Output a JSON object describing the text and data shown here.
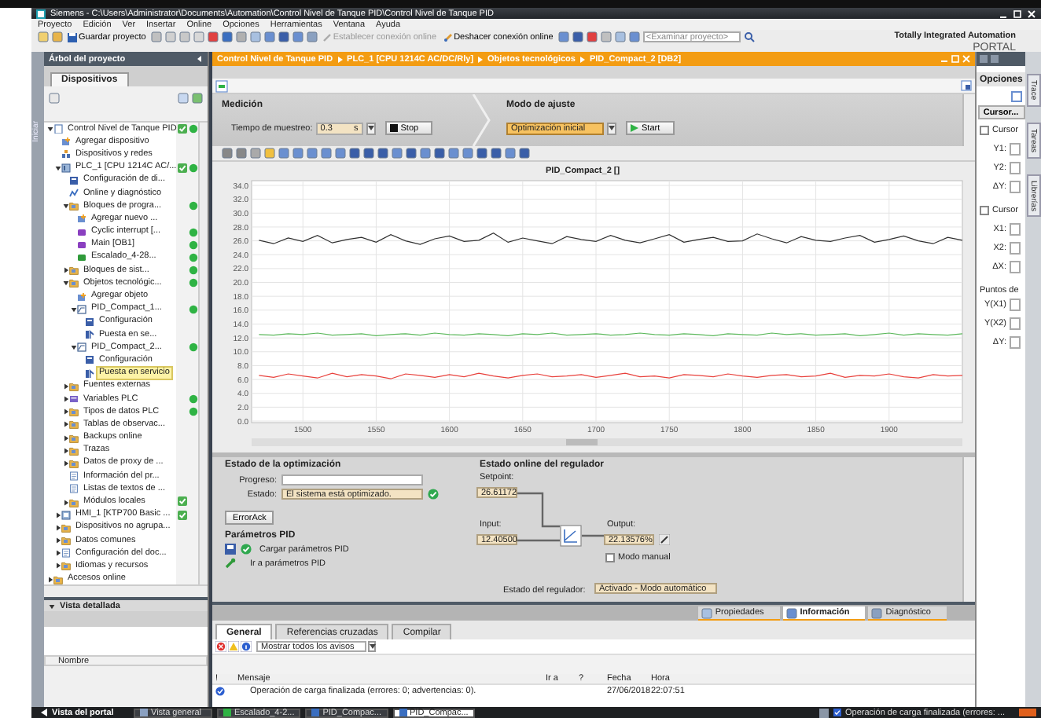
{
  "window": {
    "title": "Siemens  -  C:\\Users\\Administrator\\Documents\\Automation\\Control Nivel de Tanque PID\\Control Nivel de Tanque PID"
  },
  "menu": [
    "Proyecto",
    "Edición",
    "Ver",
    "Insertar",
    "Online",
    "Opciones",
    "Herramientas",
    "Ventana",
    "Ayuda"
  ],
  "toolbar": {
    "save": "Guardar proyecto",
    "go_online": "Establecer conexión online",
    "go_offline": "Deshacer conexión online",
    "search": {
      "placeholder": "<Examinar proyecto>"
    }
  },
  "brand": {
    "line1": "Totally Integrated Automation",
    "line2": "PORTAL"
  },
  "start_tab": "Iniciar",
  "project_tree": {
    "title": "Árbol del proyecto",
    "tab": "Dispositivos",
    "items": [
      {
        "label": "Control Nivel de Tanque PID",
        "kind": "project",
        "synced": true,
        "online": true,
        "expanded": true,
        "selected": false,
        "children": [
          {
            "label": "Agregar dispositivo",
            "kind": "add",
            "selected": false
          },
          {
            "label": "Dispositivos y redes",
            "kind": "network",
            "selected": false
          },
          {
            "label": "PLC_1 [CPU 1214C AC/...",
            "kind": "plc",
            "synced": true,
            "online": true,
            "expanded": true,
            "selected": false,
            "children": [
              {
                "label": "Configuración de di...",
                "kind": "config",
                "selected": false
              },
              {
                "label": "Online y diagnóstico",
                "kind": "diagnostics",
                "selected": false
              },
              {
                "label": "Bloques de progra...",
                "kind": "folder",
                "online": true,
                "expanded": true,
                "selected": false,
                "children": [
                  {
                    "label": "Agregar nuevo ...",
                    "kind": "add",
                    "selected": false
                  },
                  {
                    "label": "Cyclic interrupt [...",
                    "kind": "block",
                    "online": true,
                    "selected": false
                  },
                  {
                    "label": "Main [OB1]",
                    "kind": "block",
                    "online": true,
                    "selected": false
                  },
                  {
                    "label": "Escalado_4-28...",
                    "kind": "function",
                    "online": true,
                    "selected": false
                  }
                ]
              },
              {
                "label": "Bloques de sist...",
                "kind": "folder",
                "online": true,
                "expanded": false,
                "selected": false
              },
              {
                "label": "Objetos tecnológic...",
                "kind": "folder",
                "online": true,
                "expanded": true,
                "selected": false,
                "children": [
                  {
                    "label": "Agregar objeto",
                    "kind": "add",
                    "selected": false
                  },
                  {
                    "label": "PID_Compact_1...",
                    "kind": "pid",
                    "online": true,
                    "expanded": true,
                    "selected": false,
                    "children": [
                      {
                        "label": "Configuración",
                        "kind": "config",
                        "selected": false
                      },
                      {
                        "label": "Puesta en se...",
                        "kind": "commission",
                        "selected": false
                      }
                    ]
                  },
                  {
                    "label": "PID_Compact_2...",
                    "kind": "pid",
                    "online": true,
                    "expanded": true,
                    "selected": false,
                    "children": [
                      {
                        "label": "Configuración",
                        "kind": "config",
                        "selected": false
                      },
                      {
                        "label": "Puesta en servicio",
                        "kind": "commission",
                        "selected": true
                      }
                    ]
                  }
                ]
              },
              {
                "label": "Fuentes externas",
                "kind": "folder",
                "expanded": false,
                "selected": false
              },
              {
                "label": "Variables PLC",
                "kind": "tags",
                "online": true,
                "expanded": false,
                "selected": false
              },
              {
                "label": "Tipos de datos PLC",
                "kind": "folder",
                "online": true,
                "expanded": false,
                "selected": false
              },
              {
                "label": "Tablas de observac...",
                "kind": "folder",
                "expanded": false,
                "selected": false
              },
              {
                "label": "Backups online",
                "kind": "folder",
                "expanded": false,
                "selected": false
              },
              {
                "label": "Trazas",
                "kind": "folder",
                "expanded": false,
                "selected": false
              },
              {
                "label": "Datos de proxy de ...",
                "kind": "folder",
                "expanded": false,
                "selected": false
              },
              {
                "label": "Información del pr...",
                "kind": "list",
                "selected": false
              },
              {
                "label": "Listas de textos de ...",
                "kind": "list",
                "selected": false
              },
              {
                "label": "Módulos locales",
                "kind": "folder",
                "synced": true,
                "expanded": false,
                "selected": false
              }
            ]
          },
          {
            "label": "HMI_1 [KTP700 Basic ...",
            "kind": "hmi",
            "synced": true,
            "expanded": false,
            "selected": false
          },
          {
            "label": "Dispositivos no agrupa...",
            "kind": "folder",
            "expanded": false,
            "selected": false
          },
          {
            "label": "Datos comunes",
            "kind": "folder",
            "expanded": false,
            "selected": false
          },
          {
            "label": "Configuración del doc...",
            "kind": "list",
            "expanded": false,
            "selected": false
          },
          {
            "label": "Idiomas y recursos",
            "kind": "folder",
            "expanded": false,
            "selected": false
          }
        ]
      },
      {
        "label": "Accesos online",
        "kind": "folder",
        "expanded": false,
        "selected": false
      }
    ]
  },
  "details": {
    "title": "Vista detallada",
    "column": "Nombre"
  },
  "editor": {
    "breadcrumb": [
      "Control Nivel de Tanque PID",
      "PLC_1 [CPU 1214C AC/DC/Rly]",
      "Objetos tecnológicos",
      "PID_Compact_2 [DB2]"
    ],
    "measurement": {
      "title": "Medición",
      "sample_label": "Tiempo de muestreo:",
      "sample_value": "0.3",
      "unit": "s",
      "stop": "Stop"
    },
    "tuning": {
      "title": "Modo de ajuste",
      "mode": "Optimización inicial",
      "start": "Start"
    },
    "chart": {
      "chart_data": {
        "type": "line",
        "title": "PID_Compact_2 []",
        "grid": true,
        "xlim": [
          1465,
          1950
        ],
        "ylim": [
          0,
          34
        ],
        "xticks": [
          1500,
          1550,
          1600,
          1650,
          1700,
          1750,
          1800,
          1850,
          1900
        ],
        "yticks": [
          {
            "value": 34,
            "label": "34.0"
          },
          {
            "value": 32,
            "label": "32.0"
          },
          {
            "value": 30,
            "label": "30.0"
          },
          {
            "value": 28,
            "label": "28.0"
          },
          {
            "value": 26,
            "label": "26.0"
          },
          {
            "value": 24,
            "label": "24.0"
          },
          {
            "value": 22,
            "label": "22.0"
          },
          {
            "value": 20,
            "label": "20.0"
          },
          {
            "value": 18,
            "label": "18.0"
          },
          {
            "value": 16,
            "label": "16.0"
          },
          {
            "value": 14,
            "label": "14.0"
          },
          {
            "value": 12,
            "label": "12.0"
          },
          {
            "value": 10,
            "label": "10.0"
          },
          {
            "value": 8,
            "label": "8.0"
          },
          {
            "value": 6,
            "label": "6.0"
          },
          {
            "value": 4,
            "label": "4.0"
          },
          {
            "value": 2,
            "label": "2.0"
          },
          {
            "value": 0,
            "label": "0.0"
          }
        ],
        "x": [
          1470,
          1480,
          1490,
          1500,
          1510,
          1520,
          1530,
          1540,
          1550,
          1560,
          1570,
          1580,
          1590,
          1600,
          1610,
          1620,
          1630,
          1640,
          1650,
          1660,
          1670,
          1680,
          1690,
          1700,
          1710,
          1720,
          1730,
          1740,
          1750,
          1760,
          1770,
          1780,
          1790,
          1800,
          1810,
          1820,
          1830,
          1840,
          1850,
          1860,
          1870,
          1880,
          1890,
          1900,
          1910,
          1920,
          1930,
          1940,
          1950
        ],
        "series": [
          {
            "color": "#303030",
            "values": [
              26.1,
              25.6,
              26.4,
              25.9,
              26.8,
              25.7,
              26.2,
              26.5,
              25.8,
              26.9,
              26.0,
              25.5,
              26.3,
              26.7,
              25.9,
              26.1,
              27.1,
              25.8,
              26.4,
              26.0,
              25.6,
              26.6,
              26.2,
              25.9,
              26.8,
              26.1,
              25.7,
              26.3,
              26.9,
              25.8,
              26.2,
              26.5,
              25.9,
              26.0,
              27.0,
              26.3,
              25.7,
              26.6,
              26.1,
              25.9,
              26.4,
              26.8,
              25.8,
              26.2,
              26.7,
              26.0,
              25.6,
              26.5,
              26.1
            ]
          },
          {
            "color": "#5cb85c",
            "values": [
              12.5,
              12.4,
              12.6,
              12.5,
              12.7,
              12.4,
              12.5,
              12.6,
              12.3,
              12.5,
              12.6,
              12.4,
              12.7,
              12.5,
              12.4,
              12.6,
              12.5,
              12.3,
              12.6,
              12.5,
              12.7,
              12.4,
              12.5,
              12.6,
              12.4,
              12.5,
              12.7,
              12.5,
              12.4,
              12.6,
              12.5,
              12.3,
              12.6,
              12.5,
              12.4,
              12.7,
              12.5,
              12.6,
              12.4,
              12.5,
              12.6,
              12.3,
              12.5,
              12.7,
              12.4,
              12.6,
              12.5,
              12.4,
              12.6
            ]
          },
          {
            "color": "#e8413c",
            "values": [
              6.6,
              6.3,
              6.8,
              6.5,
              6.2,
              6.9,
              6.4,
              6.7,
              6.5,
              6.1,
              6.8,
              6.6,
              6.3,
              6.7,
              6.4,
              6.9,
              6.5,
              6.2,
              6.6,
              6.8,
              6.4,
              6.5,
              6.7,
              6.3,
              6.6,
              6.9,
              6.4,
              6.5,
              6.2,
              6.7,
              6.6,
              6.4,
              6.8,
              6.5,
              6.3,
              6.6,
              6.7,
              6.4,
              6.5,
              6.9,
              6.3,
              6.6,
              6.5,
              6.8,
              6.4,
              6.2,
              6.7,
              6.5,
              6.6
            ]
          }
        ]
      }
    },
    "optimization": {
      "title": "Estado de la optimización",
      "progress_label": "Progreso:",
      "status_label": "Estado:",
      "status": "El sistema está optimizado.",
      "error_ack": "ErrorAck"
    },
    "pid_params": {
      "title": "Parámetros PID",
      "load": "Cargar parámetros PID",
      "goto": "Ir a parámetros PID"
    },
    "online": {
      "title": "Estado online del regulador",
      "setpoint_label": "Setpoint:",
      "setpoint": "26.61172",
      "input_label": "Input:",
      "input": "12.40500",
      "output_label": "Output:",
      "output": "22.13576",
      "output_unit": "%",
      "manual_label": "Modo manual",
      "manual": false,
      "state_label": "Estado del regulador:",
      "state": "Activado - Modo automático"
    }
  },
  "inspector": {
    "tabs": [
      {
        "label": "Propiedades",
        "selected": false
      },
      {
        "label": "Información",
        "selected": true
      },
      {
        "label": "Diagnóstico",
        "selected": false
      }
    ],
    "subtabs": [
      {
        "label": "General",
        "selected": true
      },
      {
        "label": "Referencias cruzadas",
        "selected": false
      },
      {
        "label": "Compilar",
        "selected": false
      }
    ],
    "filter": "Mostrar todos los avisos",
    "columns": [
      "!",
      "Mensaje",
      "Ir a",
      "?",
      "Fecha",
      "Hora"
    ],
    "rows": [
      {
        "message": "Operación de carga finalizada (errores: 0; advertencias: 0).",
        "date": "27/06/2018",
        "time": "22:07:51"
      }
    ]
  },
  "options": {
    "title": "Opciones",
    "cursor_button": "Cursor...",
    "groups": [
      {
        "label": "Cursor",
        "checked": false,
        "fields": [
          "Y1:",
          "Y2:",
          "ΔY:"
        ]
      },
      {
        "label": "Cursor",
        "checked": false,
        "fields": [
          "X1:",
          "X2:",
          "ΔX:"
        ]
      }
    ],
    "points_label": "Puntos de",
    "points": [
      "Y(X1)",
      "Y(X2)",
      "ΔY:"
    ]
  },
  "side_tabs": [
    "Trace",
    "Tareas",
    "Librerías"
  ],
  "taskbar": {
    "portal": "Vista del portal",
    "items": [
      {
        "label": "Vista general",
        "selected": false
      },
      {
        "label": "Escalado_4-2...",
        "selected": false
      },
      {
        "label": "PID_Compac...",
        "selected": false
      },
      {
        "label": "PID_Compac...",
        "selected": true
      }
    ],
    "status": "Operación de carga finalizada (errores: ..."
  }
}
